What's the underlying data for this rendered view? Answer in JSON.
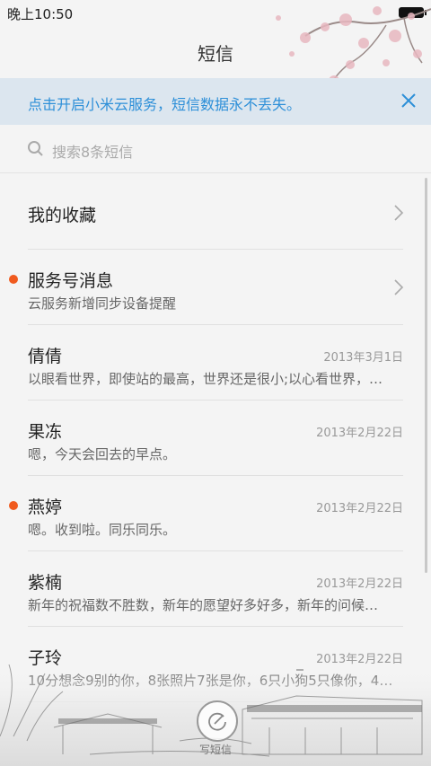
{
  "status": {
    "time": "晚上10:50"
  },
  "header": {
    "title": "短信"
  },
  "banner": {
    "text": "点击开启小米云服务，短信数据永不丢失。"
  },
  "search": {
    "placeholder": "搜索8条短信"
  },
  "list": {
    "favorites": {
      "name": "我的收藏"
    },
    "service": {
      "name": "服务号消息",
      "preview": "云服务新增同步设备提醒",
      "unread": true
    },
    "conversations": [
      {
        "name": "倩倩",
        "date": "2013年3月1日",
        "preview": "以眼看世界，即使站的最高，世界还是很小;以心看世界，…",
        "unread": false
      },
      {
        "name": "果冻",
        "date": "2013年2月22日",
        "preview": "嗯，今天会回去的早点。",
        "unread": false
      },
      {
        "name": "燕婷",
        "date": "2013年2月22日",
        "preview": "嗯。收到啦。同乐同乐。",
        "unread": true
      },
      {
        "name": "紫楠",
        "date": "2013年2月22日",
        "preview": "新年的祝福数不胜数，新年的愿望好多好多，新年的问候…",
        "unread": false
      },
      {
        "name": "子玲",
        "date": "2013年2月22日",
        "preview": "10分想念9别的你，8张照片7张是你，6只小狗5只像你，4…",
        "unread": false
      }
    ]
  },
  "compose": {
    "label": "写短信"
  },
  "colors": {
    "accent": "#2d8fd8",
    "unread_dot": "#f05a1e",
    "banner_bg": "#dce6ef"
  },
  "icons": [
    "search-icon",
    "close-icon",
    "chevron-right-icon",
    "compose-icon",
    "battery-icon"
  ]
}
